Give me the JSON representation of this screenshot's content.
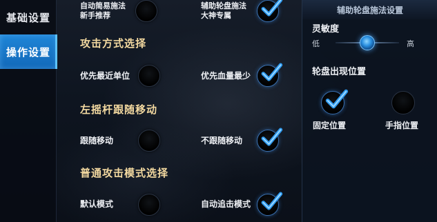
{
  "sidebar": {
    "tabs": [
      {
        "label": "基础设置",
        "active": false
      },
      {
        "label": "操作设置",
        "active": true
      }
    ]
  },
  "options": {
    "simple_cast": {
      "line1": "自动简易施法",
      "line2": "新手推荐",
      "checked": false
    },
    "wheel_cast": {
      "line1": "辅助轮盘施法",
      "line2": "大神专属",
      "checked": true
    },
    "attack_section_title": "攻击方式选择",
    "nearest_unit": {
      "label": "优先最近单位",
      "checked": false
    },
    "lowest_hp": {
      "label": "优先血量最少",
      "checked": true
    },
    "joystick_section_title": "左摇杆跟随移动",
    "follow_move": {
      "label": "跟随移动",
      "checked": false
    },
    "no_follow_move": {
      "label": "不跟随移动",
      "checked": true
    },
    "normal_attack_section_title": "普通攻击模式选择",
    "default_mode": {
      "label": "默认模式",
      "checked": false
    },
    "auto_chase_mode": {
      "label": "自动追击模式",
      "checked": true
    }
  },
  "panel": {
    "title": "辅助轮盘施法设置",
    "sensitivity_label": "灵敏度",
    "low_label": "低",
    "high_label": "高",
    "sensitivity_value": 0.5,
    "position_label": "轮盘出现位置",
    "fixed_position": {
      "label": "固定位置",
      "checked": true
    },
    "finger_position": {
      "label": "手指位置",
      "checked": false
    }
  },
  "colors": {
    "accent": "#1f86d8",
    "check": "#2f9bf0",
    "section_title": "#f3d9a0"
  }
}
